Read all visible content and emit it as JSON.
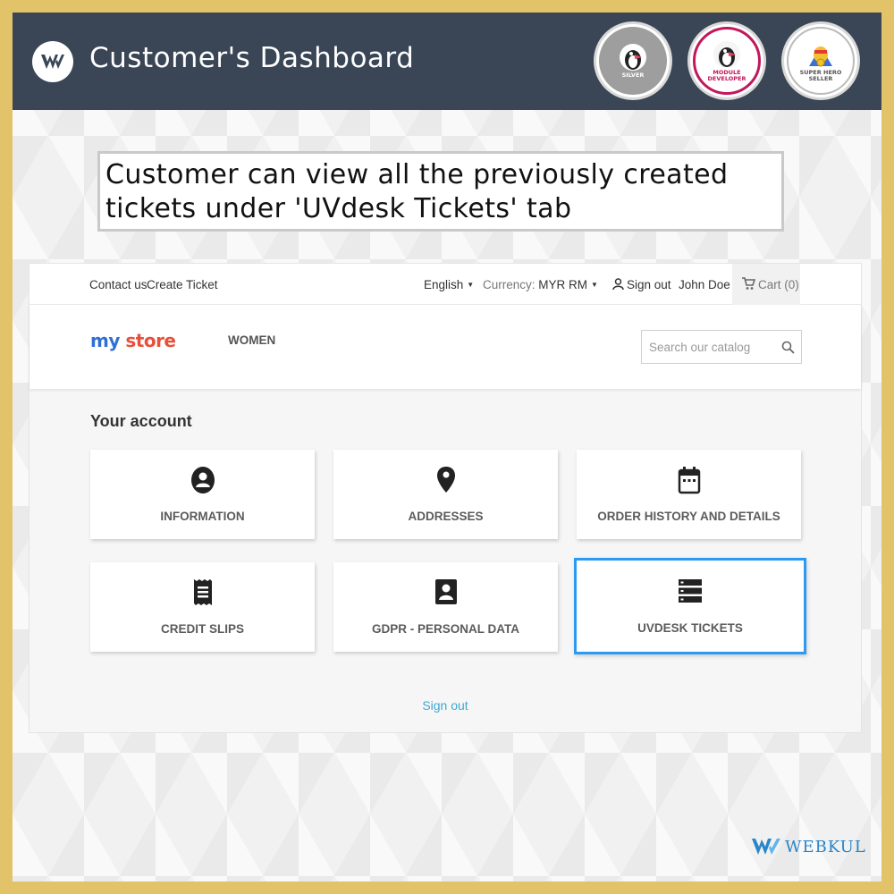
{
  "banner": {
    "title": "Customer's Dashboard",
    "badges": [
      {
        "top": "PRESTASHOP PARTNER",
        "bottom": "SILVER"
      },
      {
        "top": "PRESTASHOP PARTNER",
        "bottom": "MODULE DEVELOPER"
      },
      {
        "top": "PRESTASHOP",
        "bottom": "SUPER HERO SELLER"
      }
    ]
  },
  "caption": {
    "line1": "Customer can view all the previously created",
    "line2": "tickets under 'UVdesk Tickets' tab"
  },
  "topbar": {
    "contact": "Contact us",
    "create_ticket": "Create Ticket",
    "language": "English",
    "currency_label": "Currency:",
    "currency_value": "MYR RM",
    "sign_out": "Sign out",
    "user": "John Doe",
    "cart": "Cart (0)"
  },
  "header": {
    "logo_my": "my",
    "logo_store": "store",
    "nav_women": "WOMEN",
    "search_placeholder": "Search our catalog"
  },
  "account": {
    "title": "Your account",
    "tiles": [
      {
        "label": "INFORMATION",
        "icon": "account-circle-icon"
      },
      {
        "label": "ADDRESSES",
        "icon": "location-pin-icon"
      },
      {
        "label": "ORDER HISTORY AND DETAILS",
        "icon": "calendar-icon"
      },
      {
        "label": "CREDIT SLIPS",
        "icon": "receipt-icon"
      },
      {
        "label": "GDPR - PERSONAL DATA",
        "icon": "contact-card-icon"
      },
      {
        "label": "UVDESK TICKETS",
        "icon": "storage-list-icon"
      }
    ],
    "sign_out_link": "Sign out"
  },
  "footer": {
    "brand": "WEBKUL"
  },
  "colors": {
    "gold_border": "#e3c36a",
    "banner_bg": "#3a4656",
    "active_tile_border": "#2b9af3",
    "link": "#3ea7d4"
  }
}
